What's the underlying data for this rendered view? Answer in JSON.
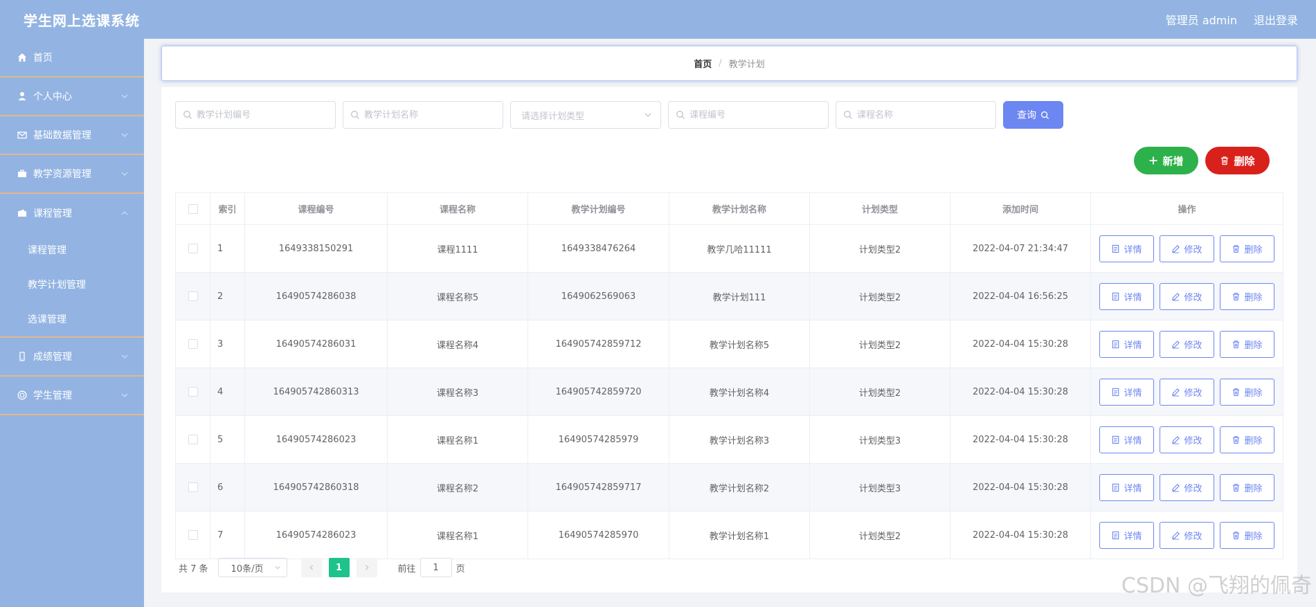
{
  "header": {
    "title": "学生网上选课系统",
    "user_label": "管理员 admin",
    "logout_label": "退出登录"
  },
  "sidebar": {
    "items": [
      {
        "label": "首页",
        "icon": "home-icon"
      },
      {
        "label": "个人中心",
        "icon": "user-icon"
      },
      {
        "label": "基础数据管理",
        "icon": "mail-icon"
      },
      {
        "label": "教学资源管理",
        "icon": "briefcase-icon"
      },
      {
        "label": "课程管理",
        "icon": "wallet-icon"
      },
      {
        "label": "成绩管理",
        "icon": "phone-icon"
      },
      {
        "label": "学生管理",
        "icon": "globe-icon"
      }
    ],
    "course_sub": [
      "课程管理",
      "教学计划管理",
      "选课管理"
    ]
  },
  "breadcrumb": {
    "home": "首页",
    "separator": "/",
    "current": "教学计划"
  },
  "search": {
    "plan_no_placeholder": "教学计划编号",
    "plan_name_placeholder": "教学计划名称",
    "plan_type_placeholder": "请选择计划类型",
    "course_no_placeholder": "课程编号",
    "course_name_placeholder": "课程名称",
    "query_label": "查询"
  },
  "actions": {
    "add_label": "新增",
    "delete_label": "删除"
  },
  "table": {
    "headers": [
      "索引",
      "课程编号",
      "课程名称",
      "教学计划编号",
      "教学计划名称",
      "计划类型",
      "添加时间",
      "操作"
    ],
    "op_labels": {
      "detail": "详情",
      "edit": "修改",
      "delete": "删除"
    },
    "rows": [
      {
        "idx": "1",
        "course_no": "1649338150291",
        "course_name": "课程1111",
        "plan_no": "1649338476264",
        "plan_name": "教学几哈11111",
        "type": "计划类型2",
        "time": "2022-04-07 21:34:47"
      },
      {
        "idx": "2",
        "course_no": "16490574286038",
        "course_name": "课程名称5",
        "plan_no": "1649062569063",
        "plan_name": "教学计划111",
        "type": "计划类型2",
        "time": "2022-04-04 16:56:25"
      },
      {
        "idx": "3",
        "course_no": "16490574286031",
        "course_name": "课程名称4",
        "plan_no": "164905742859712",
        "plan_name": "教学计划名称5",
        "type": "计划类型2",
        "time": "2022-04-04 15:30:28"
      },
      {
        "idx": "4",
        "course_no": "164905742860313",
        "course_name": "课程名称3",
        "plan_no": "164905742859720",
        "plan_name": "教学计划名称4",
        "type": "计划类型2",
        "time": "2022-04-04 15:30:28"
      },
      {
        "idx": "5",
        "course_no": "16490574286023",
        "course_name": "课程名称1",
        "plan_no": "16490574285979",
        "plan_name": "教学计划名称3",
        "type": "计划类型3",
        "time": "2022-04-04 15:30:28"
      },
      {
        "idx": "6",
        "course_no": "164905742860318",
        "course_name": "课程名称2",
        "plan_no": "164905742859717",
        "plan_name": "教学计划名称2",
        "type": "计划类型3",
        "time": "2022-04-04 15:30:28"
      },
      {
        "idx": "7",
        "course_no": "16490574286023",
        "course_name": "课程名称1",
        "plan_no": "16490574285970",
        "plan_name": "教学计划名称1",
        "type": "计划类型2",
        "time": "2022-04-04 15:30:28"
      }
    ]
  },
  "pagination": {
    "total": "共 7 条",
    "page_size": "10条/页",
    "current_page": "1",
    "goto_prefix": "前往",
    "goto_value": "1",
    "goto_suffix": "页"
  },
  "watermark": "CSDN @飞翔的佩奇",
  "colors": {
    "primary": "#6c86f2",
    "header_bg": "#93b4e2",
    "add": "#2db14b",
    "delete": "#d9211c",
    "page_active": "#1ec28b"
  }
}
